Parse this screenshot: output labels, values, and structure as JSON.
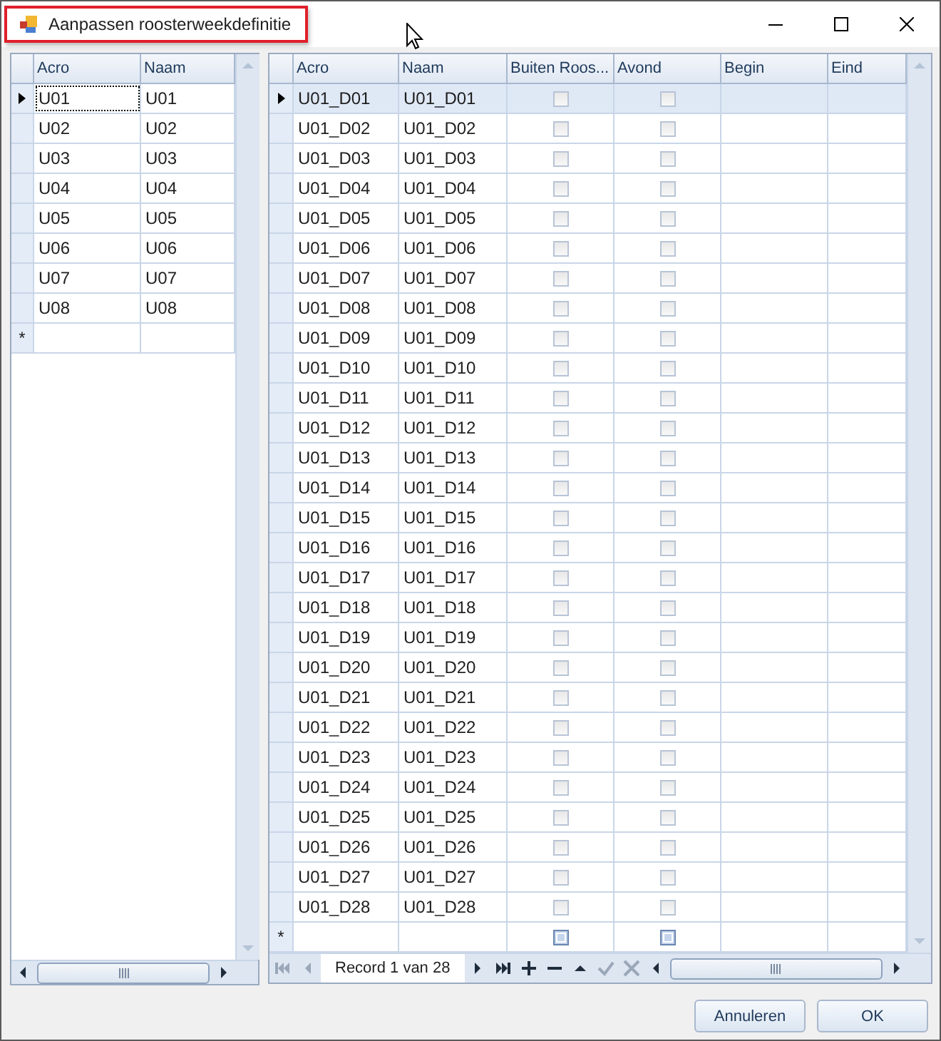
{
  "window": {
    "title": "Aanpassen roosterweekdefinitie"
  },
  "left_grid": {
    "columns": [
      "Acro",
      "Naam"
    ],
    "rows": [
      {
        "acro": "U01",
        "naam": "U01",
        "selected": true
      },
      {
        "acro": "U02",
        "naam": "U02",
        "selected": false
      },
      {
        "acro": "U03",
        "naam": "U03",
        "selected": false
      },
      {
        "acro": "U04",
        "naam": "U04",
        "selected": false
      },
      {
        "acro": "U05",
        "naam": "U05",
        "selected": false
      },
      {
        "acro": "U06",
        "naam": "U06",
        "selected": false
      },
      {
        "acro": "U07",
        "naam": "U07",
        "selected": false
      },
      {
        "acro": "U08",
        "naam": "U08",
        "selected": false
      }
    ],
    "new_row_marker": "*"
  },
  "right_grid": {
    "columns": [
      "Acro",
      "Naam",
      "Buiten Roos...",
      "Avond",
      "Begin",
      "Eind"
    ],
    "rows": [
      {
        "acro": "U01_D01",
        "naam": "U01_D01",
        "buiten_rooster": false,
        "avond": false,
        "selected": true
      },
      {
        "acro": "U01_D02",
        "naam": "U01_D02",
        "buiten_rooster": false,
        "avond": false,
        "selected": false
      },
      {
        "acro": "U01_D03",
        "naam": "U01_D03",
        "buiten_rooster": false,
        "avond": false,
        "selected": false
      },
      {
        "acro": "U01_D04",
        "naam": "U01_D04",
        "buiten_rooster": false,
        "avond": false,
        "selected": false
      },
      {
        "acro": "U01_D05",
        "naam": "U01_D05",
        "buiten_rooster": false,
        "avond": false,
        "selected": false
      },
      {
        "acro": "U01_D06",
        "naam": "U01_D06",
        "buiten_rooster": false,
        "avond": false,
        "selected": false
      },
      {
        "acro": "U01_D07",
        "naam": "U01_D07",
        "buiten_rooster": false,
        "avond": false,
        "selected": false
      },
      {
        "acro": "U01_D08",
        "naam": "U01_D08",
        "buiten_rooster": false,
        "avond": false,
        "selected": false
      },
      {
        "acro": "U01_D09",
        "naam": "U01_D09",
        "buiten_rooster": false,
        "avond": false,
        "selected": false
      },
      {
        "acro": "U01_D10",
        "naam": "U01_D10",
        "buiten_rooster": false,
        "avond": false,
        "selected": false
      },
      {
        "acro": "U01_D11",
        "naam": "U01_D11",
        "buiten_rooster": false,
        "avond": false,
        "selected": false
      },
      {
        "acro": "U01_D12",
        "naam": "U01_D12",
        "buiten_rooster": false,
        "avond": false,
        "selected": false
      },
      {
        "acro": "U01_D13",
        "naam": "U01_D13",
        "buiten_rooster": false,
        "avond": false,
        "selected": false
      },
      {
        "acro": "U01_D14",
        "naam": "U01_D14",
        "buiten_rooster": false,
        "avond": false,
        "selected": false
      },
      {
        "acro": "U01_D15",
        "naam": "U01_D15",
        "buiten_rooster": false,
        "avond": false,
        "selected": false
      },
      {
        "acro": "U01_D16",
        "naam": "U01_D16",
        "buiten_rooster": false,
        "avond": false,
        "selected": false
      },
      {
        "acro": "U01_D17",
        "naam": "U01_D17",
        "buiten_rooster": false,
        "avond": false,
        "selected": false
      },
      {
        "acro": "U01_D18",
        "naam": "U01_D18",
        "buiten_rooster": false,
        "avond": false,
        "selected": false
      },
      {
        "acro": "U01_D19",
        "naam": "U01_D19",
        "buiten_rooster": false,
        "avond": false,
        "selected": false
      },
      {
        "acro": "U01_D20",
        "naam": "U01_D20",
        "buiten_rooster": false,
        "avond": false,
        "selected": false
      },
      {
        "acro": "U01_D21",
        "naam": "U01_D21",
        "buiten_rooster": false,
        "avond": false,
        "selected": false
      },
      {
        "acro": "U01_D22",
        "naam": "U01_D22",
        "buiten_rooster": false,
        "avond": false,
        "selected": false
      },
      {
        "acro": "U01_D23",
        "naam": "U01_D23",
        "buiten_rooster": false,
        "avond": false,
        "selected": false
      },
      {
        "acro": "U01_D24",
        "naam": "U01_D24",
        "buiten_rooster": false,
        "avond": false,
        "selected": false
      },
      {
        "acro": "U01_D25",
        "naam": "U01_D25",
        "buiten_rooster": false,
        "avond": false,
        "selected": false
      },
      {
        "acro": "U01_D26",
        "naam": "U01_D26",
        "buiten_rooster": false,
        "avond": false,
        "selected": false
      },
      {
        "acro": "U01_D27",
        "naam": "U01_D27",
        "buiten_rooster": false,
        "avond": false,
        "selected": false
      },
      {
        "acro": "U01_D28",
        "naam": "U01_D28",
        "buiten_rooster": false,
        "avond": false,
        "selected": false
      }
    ],
    "new_row_marker": "*",
    "new_row": {
      "buiten_rooster_indeterminate": true,
      "avond_indeterminate": true
    },
    "navigator": {
      "record_text": "Record 1 van 28"
    }
  },
  "buttons": [
    "Annuleren",
    "OK"
  ]
}
